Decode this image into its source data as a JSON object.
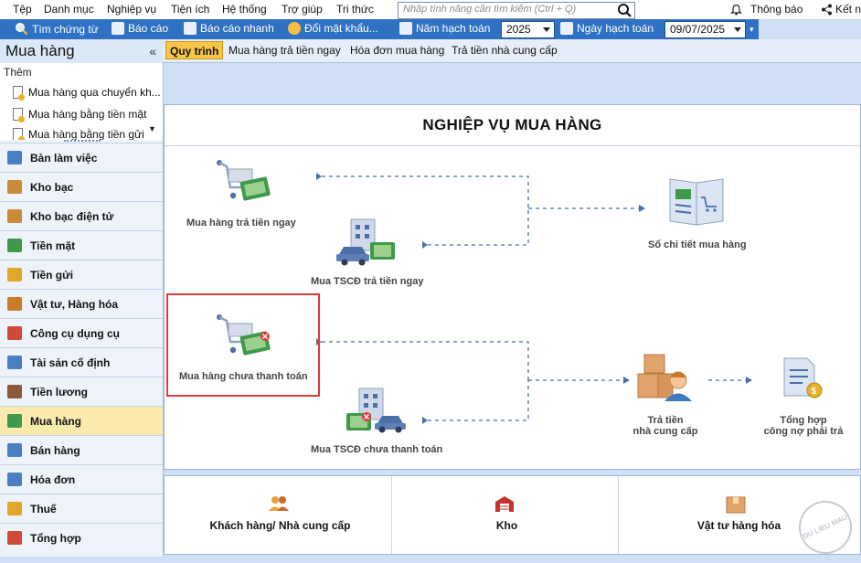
{
  "menu": {
    "items": [
      "Tệp",
      "Danh mục",
      "Nghiệp vụ",
      "Tiện ích",
      "Hệ thống",
      "Trợ giúp",
      "Tri thức"
    ],
    "search_placeholder": "Nhập tính năng cần tìm kiếm (Ctrl + Q)",
    "notifications": "Thông báo",
    "connect": "Kết n"
  },
  "toolbar": {
    "find_voucher": "Tìm chứng từ",
    "report": "Báo cáo",
    "quick_report": "Báo cáo nhanh",
    "change_password": "Đổi mật khẩu...",
    "fiscal_year_label": "Năm hạch toán",
    "fiscal_year_value": "2025",
    "posting_date_label": "Ngày hạch toán",
    "posting_date_value": "09/07/2025"
  },
  "left_panel": {
    "title": "Mua hàng",
    "collapse": "«",
    "quick_add_label": "Thêm",
    "quick_items": [
      "Mua hàng qua chuyển kh...",
      "Mua hàng bằng tiền mặt",
      "Mua hàng bằng tiền gửi"
    ],
    "nav": [
      {
        "label": "Bàn làm việc",
        "icon": "desk-icon",
        "color": "#4a7fc4"
      },
      {
        "label": "Kho bạc",
        "icon": "treasury-icon",
        "color": "#c98a3a"
      },
      {
        "label": "Kho bạc điện tử",
        "icon": "e-treasury-icon",
        "color": "#c98a3a"
      },
      {
        "label": "Tiền mặt",
        "icon": "cash-icon",
        "color": "#3e9a4a"
      },
      {
        "label": "Tiền gửi",
        "icon": "deposit-icon",
        "color": "#e2a62a"
      },
      {
        "label": "Vật tư, Hàng hóa",
        "icon": "goods-icon",
        "color": "#c97a2a"
      },
      {
        "label": "Công cụ dụng cụ",
        "icon": "tools-icon",
        "color": "#d04a3a"
      },
      {
        "label": "Tài sản cố định",
        "icon": "fixed-asset-icon",
        "color": "#4a7fc4"
      },
      {
        "label": "Tiền lương",
        "icon": "payroll-icon",
        "color": "#8a5a3a"
      },
      {
        "label": "Mua hàng",
        "icon": "purchase-cart-icon",
        "color": "#3e9a4a",
        "active": true
      },
      {
        "label": "Bán hàng",
        "icon": "sales-icon",
        "color": "#4a7fc4"
      },
      {
        "label": "Hóa đơn",
        "icon": "invoice-icon",
        "color": "#4a7fc4"
      },
      {
        "label": "Thuế",
        "icon": "tax-icon",
        "color": "#e2a62a"
      },
      {
        "label": "Tổng hợp",
        "icon": "summary-icon",
        "color": "#d04a3a"
      }
    ]
  },
  "tabs": [
    "Quy trình",
    "Mua hàng trả tiền ngay",
    "Hóa đơn mua hàng",
    "Trả tiền nhà cung cấp"
  ],
  "process": {
    "title": "NGHIỆP VỤ MUA HÀNG",
    "nodes": {
      "buy_pay_now": "Mua hàng trả tiền ngay",
      "asset_pay_now": "Mua TSCĐ trả tiền ngay",
      "buy_unpaid": "Mua hàng chưa thanh toán",
      "asset_unpaid": "Mua TSCĐ chưa thanh toán",
      "purchase_ledger": "Sổ chi tiết mua hàng",
      "pay_supplier_line1": "Trả tiền",
      "pay_supplier_line2": "nhà cung cấp",
      "payables_summary_line1": "Tổng hợp",
      "payables_summary_line2": "công nợ phải trả"
    }
  },
  "bottom": {
    "customer_supplier": "Khách hàng/ Nhà cung cấp",
    "warehouse": "Kho",
    "goods": "Vật tư hàng hóa"
  },
  "watermark": "DU LIEU MAU",
  "colors": {
    "accent": "#2f72c4",
    "active_tab": "#f7c547",
    "highlight": "#e0383e"
  }
}
